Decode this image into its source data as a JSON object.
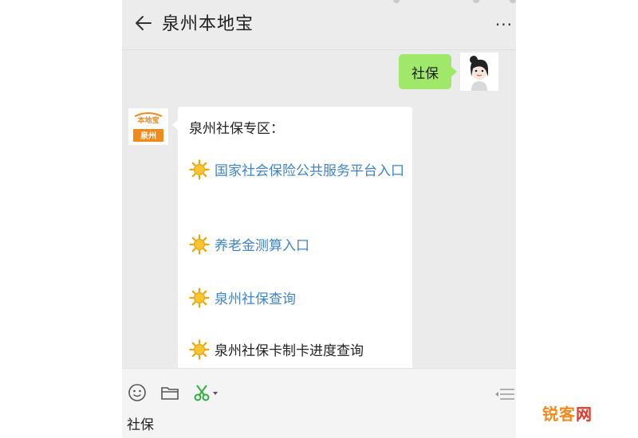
{
  "header": {
    "title": "泉州本地宝"
  },
  "chat": {
    "user_message": "社保",
    "bot": {
      "intro": "泉州社保专区：",
      "links": [
        {
          "label": "国家社会保险公共服务平台入口"
        },
        {
          "label": "养老金测算入口"
        },
        {
          "label": "泉州社保查询"
        },
        {
          "label": "泉州社保卡制卡进度查询"
        }
      ],
      "avatar_text_top": "本地宝",
      "avatar_text_bottom": "泉州"
    }
  },
  "input": {
    "value": "社保"
  },
  "watermark": {
    "part1": "锐客",
    "part2": "网"
  },
  "icons": [
    "back-arrow-icon",
    "more-icon",
    "sun-icon",
    "emoji-icon",
    "folder-icon",
    "scissors-icon",
    "list-icon"
  ],
  "colors": {
    "link": "#3d84c7",
    "bubble_right": "#9fe86a",
    "brand_orange": "#f08a1c"
  }
}
